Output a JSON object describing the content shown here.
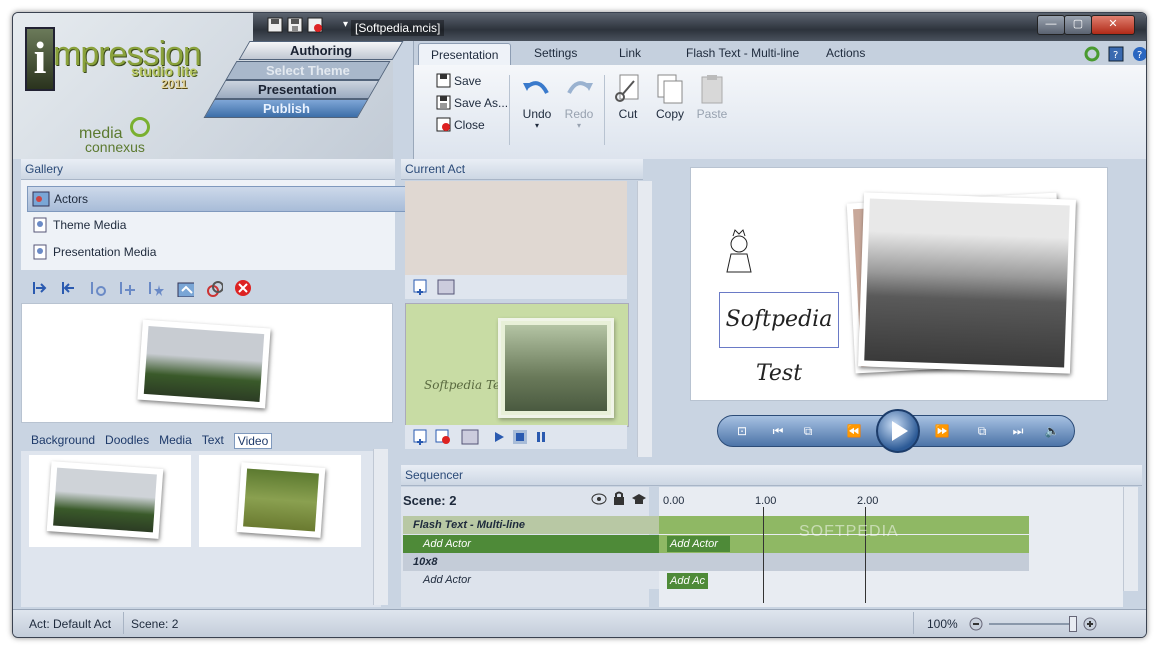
{
  "window": {
    "title": "[Softpedia.mcis]"
  },
  "logo": {
    "name": "mpression",
    "letter": "i",
    "edition": "studio lite",
    "year": "2011",
    "brand_line1": "media",
    "brand_line2": "connexus"
  },
  "nav": {
    "authoring": "Authoring",
    "select_theme": "Select Theme",
    "presentation": "Presentation",
    "publish": "Publish"
  },
  "ribbon": {
    "tabs": [
      "Presentation",
      "Settings",
      "Link",
      "Flash Text - Multi-line",
      "Actions"
    ],
    "save": "Save",
    "save_as": "Save As...",
    "close": "Close",
    "undo": "Undo",
    "redo": "Redo",
    "cut": "Cut",
    "copy": "Copy",
    "paste": "Paste"
  },
  "gallery": {
    "title": "Gallery",
    "items": [
      "Actors",
      "Theme Media",
      "Presentation Media"
    ],
    "media_tabs": [
      "Background",
      "Doodles",
      "Media",
      "Text",
      "Video"
    ],
    "selected_media_tab": "Video"
  },
  "current_act": {
    "title": "Current Act",
    "preview_text": "Softpedia Test"
  },
  "stage": {
    "text_box": "Softpedia Test"
  },
  "sequencer": {
    "title": "Sequencer",
    "scene_label": "Scene: 2",
    "ticks": [
      "0.00",
      "1.00",
      "2.00"
    ],
    "rows": [
      {
        "name": "Flash Text - Multi-line",
        "kind": "header"
      },
      {
        "name": "Add Actor",
        "kind": "action",
        "clip": "Add Actor"
      },
      {
        "name": "10x8",
        "kind": "header"
      },
      {
        "name": "Add Actor",
        "kind": "action",
        "clip": "Add Ac"
      }
    ],
    "watermark": "SOFTPEDIA"
  },
  "status": {
    "act": "Act: Default Act",
    "scene": "Scene: 2",
    "zoom": "100%"
  },
  "colors": {
    "accent": "#3c6ea8",
    "timeline_green": "#8fb864",
    "clip_green": "#4e8a38"
  }
}
